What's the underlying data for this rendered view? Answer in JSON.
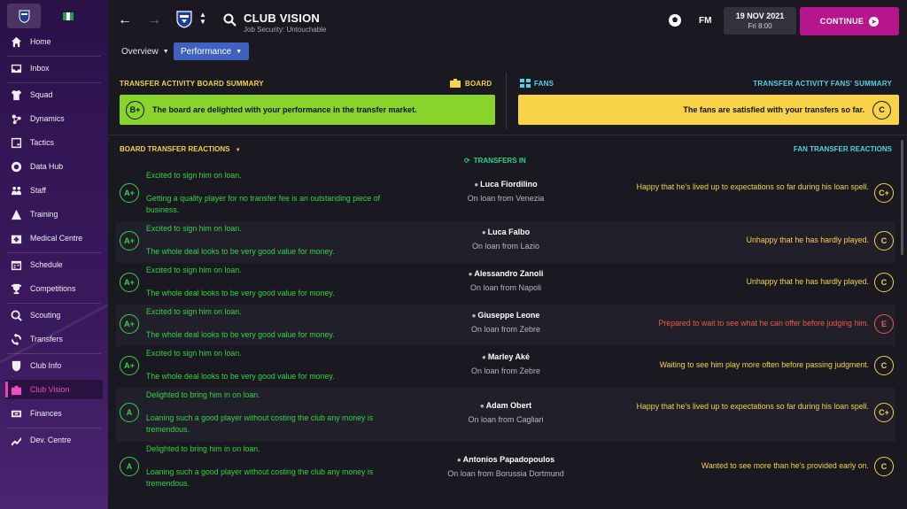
{
  "sidebar": {
    "flag_colors": [
      "#1aa34a",
      "#ffffff",
      "#1aa34a"
    ],
    "items": [
      {
        "label": "Home",
        "icon": "home-icon"
      },
      {
        "label": "Inbox",
        "icon": "inbox-icon"
      },
      {
        "label": "Squad",
        "icon": "squad-icon"
      },
      {
        "label": "Dynamics",
        "icon": "dynamics-icon"
      },
      {
        "label": "Tactics",
        "icon": "tactics-icon"
      },
      {
        "label": "Data Hub",
        "icon": "data-hub-icon"
      },
      {
        "label": "Staff",
        "icon": "staff-icon"
      },
      {
        "label": "Training",
        "icon": "training-icon"
      },
      {
        "label": "Medical Centre",
        "icon": "medical-icon"
      },
      {
        "label": "Schedule",
        "icon": "schedule-icon"
      },
      {
        "label": "Competitions",
        "icon": "trophy-icon"
      },
      {
        "label": "Scouting",
        "icon": "scouting-icon"
      },
      {
        "label": "Transfers",
        "icon": "transfers-icon"
      },
      {
        "label": "Club Info",
        "icon": "club-info-icon"
      },
      {
        "label": "Club Vision",
        "icon": "club-vision-icon"
      },
      {
        "label": "Finances",
        "icon": "finances-icon"
      },
      {
        "label": "Dev. Centre",
        "icon": "dev-centre-icon"
      }
    ]
  },
  "header": {
    "title": "CLUB VISION",
    "subtitle": "Job Security: Untouchable",
    "fm_label": "FM",
    "date": "19 NOV 2021",
    "day_time": "Fri 8:00",
    "continue_label": "CONTINUE"
  },
  "tabs": {
    "overview": "Overview",
    "performance": "Performance"
  },
  "summary": {
    "board_heading": "TRANSFER ACTIVITY BOARD SUMMARY",
    "board_label": "BOARD",
    "board_grade": "B+",
    "board_text": "The board are delighted with your performance in the transfer market.",
    "fans_label": "FANS",
    "fans_heading": "TRANSFER ACTIVITY FANS' SUMMARY",
    "fans_grade": "C",
    "fans_text": "The fans are satisfied with your transfers so far."
  },
  "reactions": {
    "board_heading": "BOARD TRANSFER REACTIONS",
    "transfers_in": "TRANSFERS IN",
    "fans_heading": "FAN TRANSFER REACTIONS",
    "rows": [
      {
        "board_grade": "A+",
        "board_line1": "Excited to sign him on loan.",
        "board_line2": "Getting a quality player for no transfer fee is an outstanding piece of business.",
        "player": "Luca Fiordilino",
        "loan": "On loan from Venezia",
        "fan_text": "Happy that he's lived up to expectations so far during his loan spell.",
        "fan_grade": "C+",
        "fan_color": "yellow"
      },
      {
        "board_grade": "A+",
        "board_line1": "Excited to sign him on loan.",
        "board_line2": "The whole deal looks to be very good value for money.",
        "player": "Luca Falbo",
        "loan": "On loan from Lazio",
        "fan_text": "Unhappy that he has hardly played.",
        "fan_grade": "C",
        "fan_color": "yellow"
      },
      {
        "board_grade": "A+",
        "board_line1": "Excited to sign him on loan.",
        "board_line2": "The whole deal looks to be very good value for money.",
        "player": "Alessandro Zanoli",
        "loan": "On loan from Napoli",
        "fan_text": "Unhappy that he has hardly played.",
        "fan_grade": "C",
        "fan_color": "yellow"
      },
      {
        "board_grade": "A+",
        "board_line1": "Excited to sign him on loan.",
        "board_line2": "The whole deal looks to be very good value for money.",
        "player": "Giuseppe Leone",
        "loan": "On loan from Zebre",
        "fan_text": "Prepared to wait to see what he can offer before judging him.",
        "fan_grade": "E",
        "fan_color": "red"
      },
      {
        "board_grade": "A+",
        "board_line1": "Excited to sign him on loan.",
        "board_line2": "The whole deal looks to be very good value for money.",
        "player": "Marley Aké",
        "loan": "On loan from Zebre",
        "fan_text": "Waiting to see him play more often before passing judgment.",
        "fan_grade": "C",
        "fan_color": "yellow"
      },
      {
        "board_grade": "A",
        "board_line1": "Delighted to bring him in on loan.",
        "board_line2": "Loaning such a good player without costing the club any money is tremendous.",
        "player": "Adam Obert",
        "loan": "On loan from Cagliari",
        "fan_text": "Happy that he's lived up to expectations so far during his loan spell.",
        "fan_grade": "C+",
        "fan_color": "yellow"
      },
      {
        "board_grade": "A",
        "board_line1": "Delighted to bring him in on loan.",
        "board_line2": "Loaning such a good player without costing the club any money is tremendous.",
        "player": "Antonios Papadopoulos",
        "loan": "On loan from Borussia Dortmund",
        "fan_text": "Wanted to see more than he's provided early on.",
        "fan_grade": "C",
        "fan_color": "yellow"
      }
    ]
  },
  "colors": {
    "accent_magenta": "#b6168d",
    "board_green": "#88d42c",
    "fans_yellow": "#f8d34a",
    "reaction_green": "#35d447",
    "fan_red": "#f05a48",
    "cyan": "#4fd3e6",
    "tab_blue": "#3f62c2"
  }
}
